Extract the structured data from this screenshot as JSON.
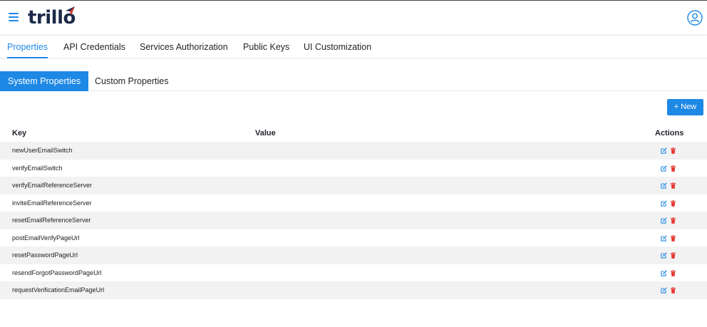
{
  "app": {
    "logo_text": "trillo",
    "brand_color": "#1e88e5",
    "logo_accent": "#e53935",
    "danger_color": "#e53935"
  },
  "tabs": [
    {
      "label": "Properties",
      "active": true
    },
    {
      "label": "API Credentials",
      "active": false
    },
    {
      "label": "Services Authorization",
      "active": false
    },
    {
      "label": "Public Keys",
      "active": false
    },
    {
      "label": "UI Customization",
      "active": false
    }
  ],
  "subtabs": [
    {
      "label": "System Properties",
      "active": true
    },
    {
      "label": "Custom Properties",
      "active": false
    }
  ],
  "toolbar": {
    "new_label": "+ New"
  },
  "table": {
    "headers": {
      "key": "Key",
      "value": "Value",
      "actions": "Actions"
    },
    "rows": [
      {
        "key": "newUserEmailSwitch",
        "value": ""
      },
      {
        "key": "verifyEmailSwitch",
        "value": ""
      },
      {
        "key": "verifyEmailReferenceServer",
        "value": ""
      },
      {
        "key": "inviteEmailReferenceServer",
        "value": ""
      },
      {
        "key": "resetEmailReferenceServer",
        "value": ""
      },
      {
        "key": "postEmailVerifyPageUrl",
        "value": ""
      },
      {
        "key": "resetPasswordPageUrl",
        "value": ""
      },
      {
        "key": "resendForgotPasswordPageUrl",
        "value": ""
      },
      {
        "key": "requestVerificationEmailPageUrl",
        "value": ""
      }
    ],
    "row_icons": {
      "edit": "edit-icon",
      "delete": "trash-icon"
    }
  }
}
